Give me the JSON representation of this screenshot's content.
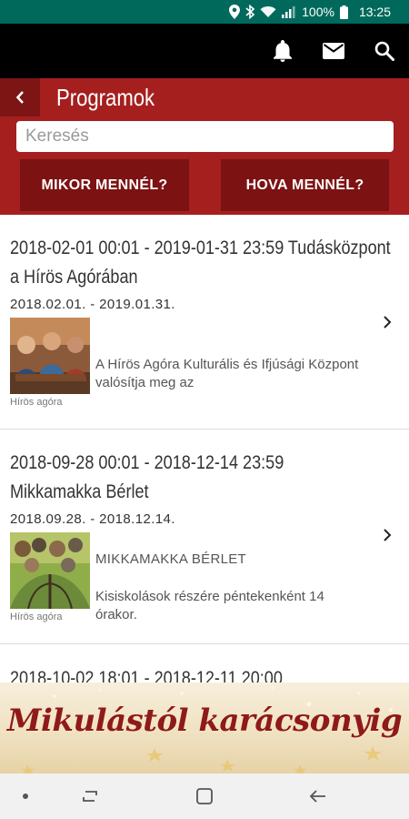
{
  "status_bar": {
    "battery": "100%",
    "time": "13:25",
    "icons": [
      "location-icon",
      "bluetooth-icon",
      "wifi-icon",
      "signal-icon",
      "battery-icon"
    ]
  },
  "app_bar": {
    "icons": [
      "bell-icon",
      "mail-icon",
      "search-icon"
    ]
  },
  "header": {
    "title": "Programok",
    "search_placeholder": "Keresés",
    "when_button": "MIKOR MENNÉL?",
    "where_button": "HOVA MENNÉL?"
  },
  "events": [
    {
      "title_line1": "2018-02-01 00:01 - 2019-01-31 23:59 Tudásközpont",
      "title_line2": "a Hírös Agórában",
      "date_range": "2018.02.01. - 2019.01.31.",
      "subtitle": "",
      "description": "A Hírös Agóra Kulturális és Ifjúsági Központ valósítja meg az",
      "source": "Hírös agóra"
    },
    {
      "title_line1": "2018-09-28 00:01 - 2018-12-14 23:59",
      "title_line2": "Mikkamakka Bérlet",
      "date_range": "2018.09.28. - 2018.12.14.",
      "subtitle": "MIKKAMAKKA BÉRLET",
      "description": "Kisiskolások részére péntekenként 14 órakor.",
      "source": "Hírös agóra"
    },
    {
      "title_line1": "2018-10-02 18:01 - 2018-12-11 20:00"
    }
  ],
  "banner": {
    "text": "Mikulástól karácsonyig"
  },
  "nav_bar": {
    "icons": [
      "dot-icon",
      "recents-icon",
      "home-icon",
      "back-icon"
    ]
  },
  "colors": {
    "status_bar": "#00695c",
    "header_red": "#a51f1f",
    "button_dark_red": "#7c1212",
    "banner_text": "#8e1a1a"
  }
}
